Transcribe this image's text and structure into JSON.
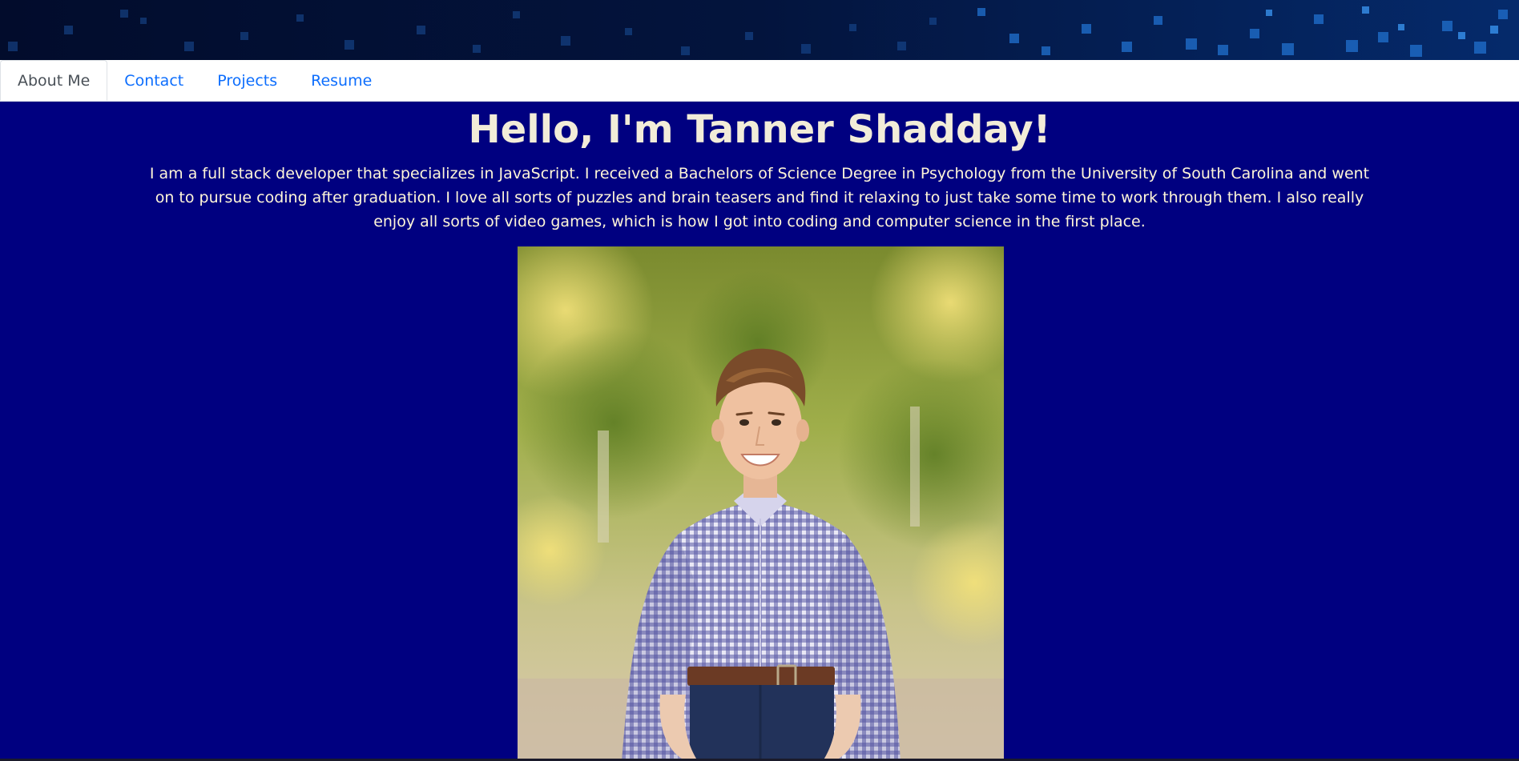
{
  "nav": {
    "items": [
      {
        "label": "About Me",
        "active": true
      },
      {
        "label": "Contact",
        "active": false
      },
      {
        "label": "Projects",
        "active": false
      },
      {
        "label": "Resume",
        "active": false
      }
    ]
  },
  "hero": {
    "title": "Hello, I'm Tanner Shadday!",
    "intro": "I am a full stack developer that specializes in JavaScript. I received a Bachelors of Science Degree in Psychology from the University of South Carolina and went on to pursue coding after graduation. I love all sorts of puzzles and brain teasers and find it relaxing to just take some time to work through them. I also really enjoy all sorts of video games, which is how I got into coding and computer science in the first place."
  },
  "colors": {
    "page_background": "#000080",
    "heading_text": "#f2ecd8",
    "body_text": "#fff6d8",
    "nav_link": "#0d6efd",
    "nav_active": "#495057"
  }
}
